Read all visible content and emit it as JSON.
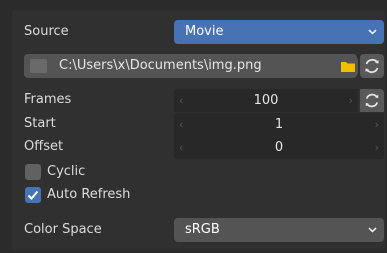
{
  "source": {
    "label": "Source",
    "value": "Movie"
  },
  "filepath": {
    "value": "C:\\Users\\x\\Documents\\img.png"
  },
  "fields": {
    "frames": {
      "label": "Frames",
      "value": "100"
    },
    "start": {
      "label": "Start",
      "value": "1"
    },
    "offset": {
      "label": "Offset",
      "value": "0"
    }
  },
  "options": {
    "cyclic": {
      "label": "Cyclic",
      "checked": false
    },
    "auto_refresh": {
      "label": "Auto Refresh",
      "checked": true
    }
  },
  "color_space": {
    "label": "Color Space",
    "value": "sRGB"
  },
  "icons": {
    "file": "image-file-icon",
    "folder": "folder-icon",
    "refresh": "refresh-icon",
    "dropdown": "chevron-down-icon"
  },
  "colors": {
    "accent": "#4772b3",
    "folder": "#f0c000",
    "field_bg": "#282828",
    "widget_bg": "#545454"
  }
}
